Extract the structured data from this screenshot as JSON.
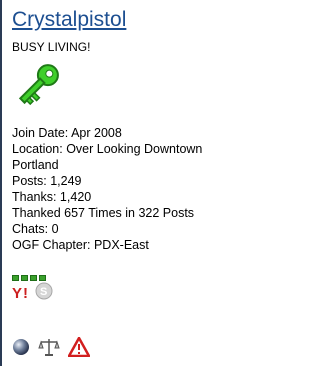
{
  "user": {
    "username": "Crystalpistol",
    "title": "BUSY LIVING!"
  },
  "stats": {
    "join_date": "Join Date: Apr 2008",
    "location_line1": "Location: Over Looking Downtown",
    "location_line2": "Portland",
    "posts": "Posts: 1,249",
    "thanks": "Thanks: 1,420",
    "thanked": "Thanked 657 Times in 322 Posts",
    "chats": "Chats: 0",
    "chapter": "OGF Chapter: PDX-East"
  },
  "reputation": {
    "level": 4
  },
  "icons": {
    "key": "green-key-icon",
    "yahoo": "yahoo-im-icon",
    "skype": "skype-im-icon",
    "online": "online-status-icon",
    "scales": "report-post-icon",
    "warning": "warning-icon"
  },
  "colors": {
    "link": "#1d4f91",
    "rep_green": "#3aa12c",
    "key_green": "#3fcf2a",
    "border": "#2a3b55"
  }
}
